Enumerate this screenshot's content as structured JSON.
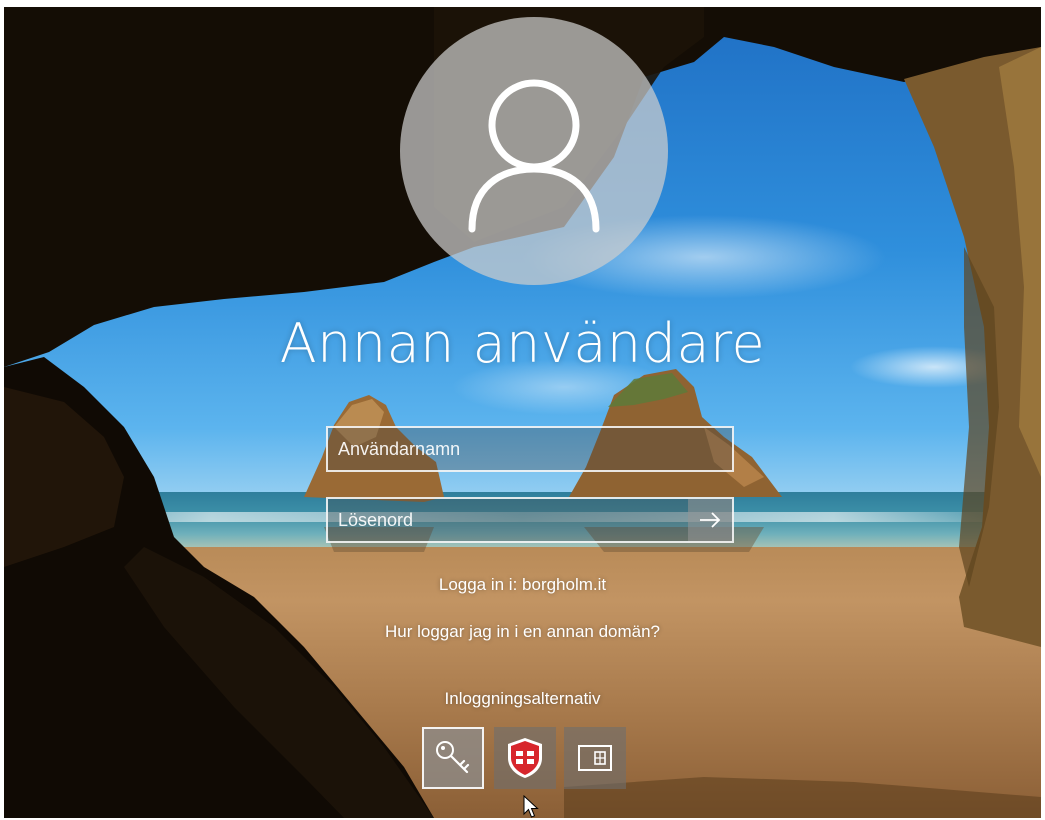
{
  "user": {
    "display_name": "Annan användare",
    "avatar_icon": "user-silhouette-icon"
  },
  "fields": {
    "username_placeholder": "Användarnamn",
    "password_placeholder": "Lösenord",
    "submit_icon": "arrow-right-icon"
  },
  "links": {
    "signin_domain": "Logga in i: borgholm.it",
    "other_domain": "Hur loggar jag in i en annan domän?"
  },
  "signin_options": {
    "title": "Inloggningsalternativ",
    "items": [
      {
        "name": "password-key-icon",
        "selected": true
      },
      {
        "name": "fortinet-shield-icon",
        "selected": false
      },
      {
        "name": "smart-card-icon",
        "selected": false
      }
    ]
  },
  "colors": {
    "text": "#ffffff",
    "shield_red": "#d7262c"
  }
}
